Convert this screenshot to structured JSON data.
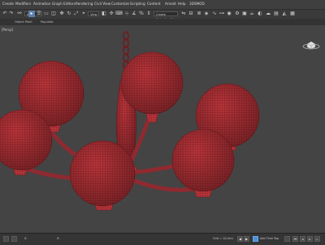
{
  "menubar": {
    "items": [
      "Create",
      "Modifiers",
      "Animation",
      "Graph Editors",
      "Rendering",
      "Civil View",
      "Customize",
      "Scripting",
      "Content",
      "Arnold",
      "Help",
      "3DSMOD"
    ]
  },
  "toolbar": {
    "selection_filter": "All",
    "view_dropdown": "View",
    "named_selection": "Create Selection Set"
  },
  "ribbon": {
    "tabs": [
      "Object Paint",
      "Populate"
    ]
  },
  "viewport": {
    "label": "[+] [Perspective] [Standard] [Default Shading]",
    "label_short": "[Persp]"
  },
  "statusbar": {
    "coords_x": "X: ",
    "coords_z": "Z: ",
    "grid": "Grid = 10,0cm",
    "add_time_tag": "Add Time Tag",
    "auto_key": "Auto",
    "frame": "0",
    "set_key": "Selected"
  },
  "colors": {
    "mesh_red": "#b8343a",
    "viewport_bg": "#444444",
    "accent_blue": "#4a8fd8"
  }
}
